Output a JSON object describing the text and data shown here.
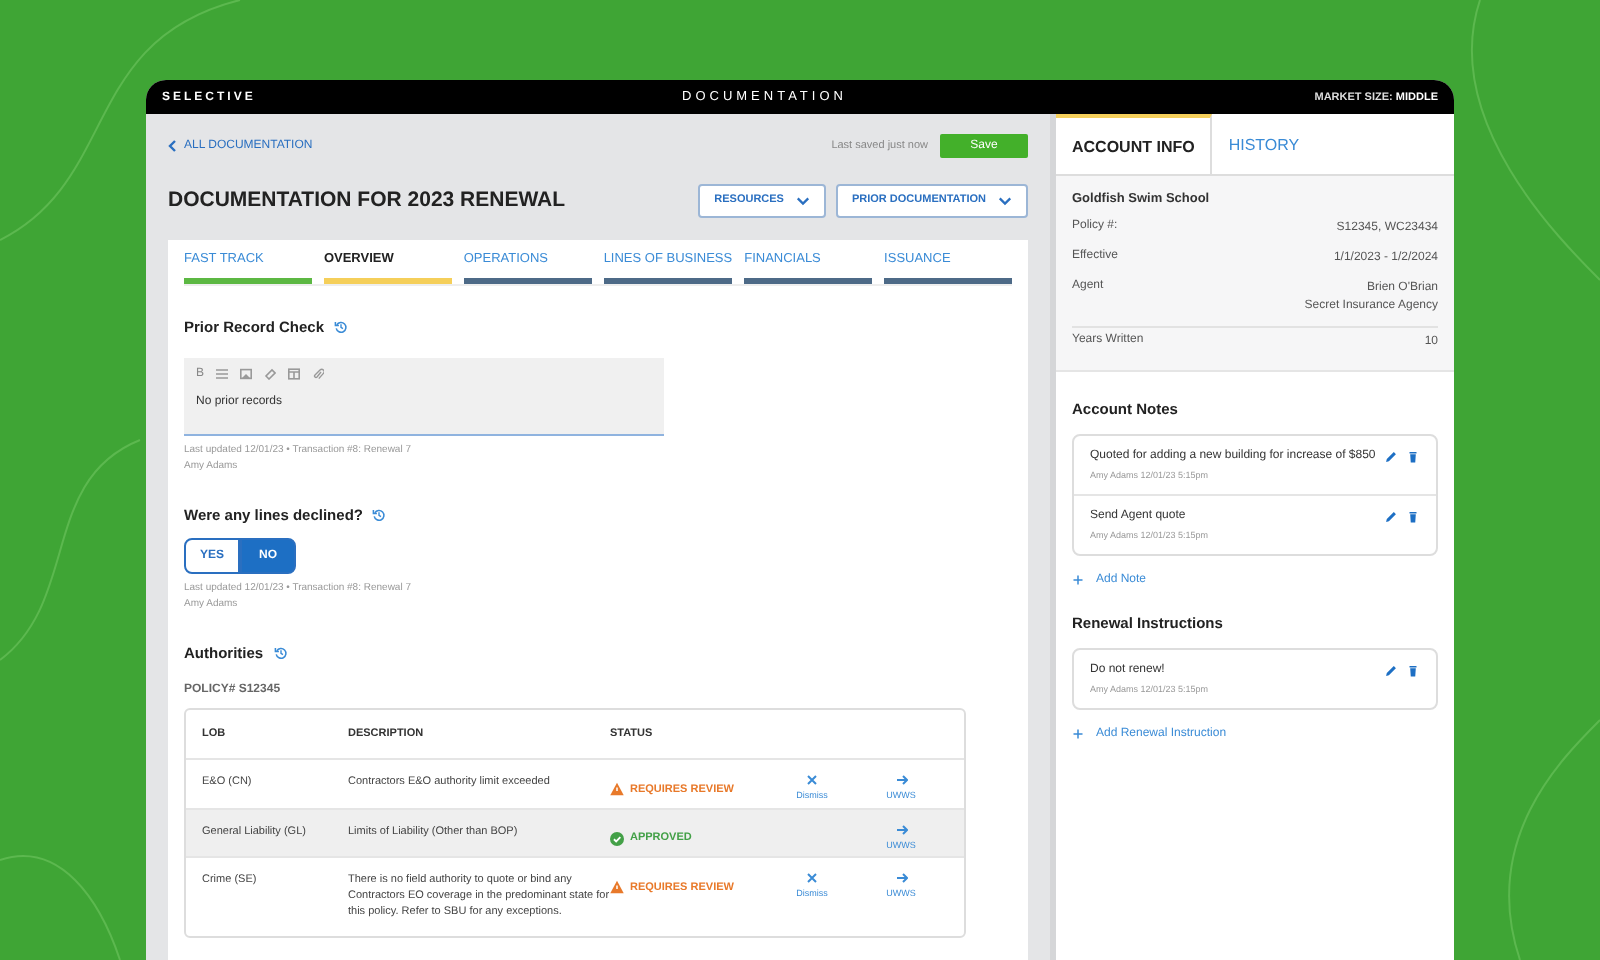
{
  "header": {
    "logo": "SELECTIVE",
    "title": "DOCUMENTATION",
    "market_label": "MARKET SIZE:",
    "market_value": "MIDDLE"
  },
  "back_link": "ALL DOCUMENTATION",
  "save_status": "Last saved just now",
  "save_button": "Save",
  "page_title": "DOCUMENTATION FOR 2023 RENEWAL",
  "dropdowns": [
    "RESOURCES",
    "PRIOR DOCUMENTATION"
  ],
  "tabs": [
    {
      "label": "FAST TRACK",
      "selected": false,
      "color": "#5cb843"
    },
    {
      "label": "OVERVIEW",
      "selected": true,
      "color": "#f5cf5a"
    },
    {
      "label": "OPERATIONS",
      "selected": false,
      "color": "#4d6a87"
    },
    {
      "label": "LINES OF BUSINESS",
      "selected": false,
      "color": "#4d6a87"
    },
    {
      "label": "FINANCIALS",
      "selected": false,
      "color": "#4d6a87"
    },
    {
      "label": "ISSUANCE",
      "selected": false,
      "color": "#4d6a87"
    }
  ],
  "prior_record": {
    "title": "Prior Record Check",
    "bold_glyph": "B",
    "value": "No prior records",
    "meta": "Last updated 12/01/23 • Transaction #8: Renewal 7",
    "author": "Amy Adams"
  },
  "declined": {
    "title": "Were any lines declined?",
    "options": [
      {
        "label": "YES",
        "selected": false
      },
      {
        "label": "NO",
        "selected": true
      }
    ],
    "meta": "Last updated 12/01/23 • Transaction #8: Renewal 7",
    "author": "Amy Adams"
  },
  "authorities": {
    "title": "Authorities",
    "policy": "POLICY# S12345",
    "columns": [
      "LOB",
      "DESCRIPTION",
      "STATUS"
    ],
    "rows": [
      {
        "lob": "E&O (CN)",
        "description": "Contractors E&O authority limit exceeded",
        "status": {
          "kind": "review",
          "label": "REQUIRES REVIEW"
        },
        "dismiss": "Dismiss",
        "uwws": "UWWS",
        "selected": false
      },
      {
        "lob": "General Liability (GL)",
        "description": "Limits of Liability (Other than BOP)",
        "status": {
          "kind": "approved",
          "label": "APPROVED"
        },
        "uwws": "UWWS",
        "selected": true
      },
      {
        "lob": "Crime (SE)",
        "description": "There is no field authority to quote or bind any Contractors EO coverage in the predominant state for this policy. Refer to SBU for any exceptions.",
        "status": {
          "kind": "review",
          "label": "REQUIRES REVIEW"
        },
        "dismiss": "Dismiss",
        "uwws": "UWWS",
        "selected": false
      }
    ]
  },
  "side_tabs": [
    {
      "label": "ACCOUNT INFO",
      "selected": true
    },
    {
      "label": "HISTORY",
      "selected": false
    }
  ],
  "account": {
    "name": "Goldfish Swim School",
    "fields": [
      {
        "label": "Policy #:",
        "value": [
          "S12345, WC23434"
        ]
      },
      {
        "label": "Effective",
        "value": [
          "1/1/2023 - 1/2/2024"
        ]
      },
      {
        "label": "Agent",
        "value": [
          "Brien O'Brian",
          "Secret Insurance Agency"
        ]
      },
      {
        "label": "Years Written",
        "value": [
          "10"
        ]
      }
    ]
  },
  "notes": {
    "title": "Account Notes",
    "items": [
      {
        "text": "Quoted for adding a new building for increase of $850",
        "meta": "Amy Adams 12/01/23 5:15pm"
      },
      {
        "text": "Send Agent quote",
        "meta": "Amy Adams 12/01/23 5:15pm"
      }
    ],
    "add": "Add Note"
  },
  "instructions": {
    "title": "Renewal Instructions",
    "items": [
      {
        "text": "Do not renew!",
        "meta": "Amy Adams 12/01/23 5:15pm"
      }
    ],
    "add": "Add Renewal Instruction"
  }
}
